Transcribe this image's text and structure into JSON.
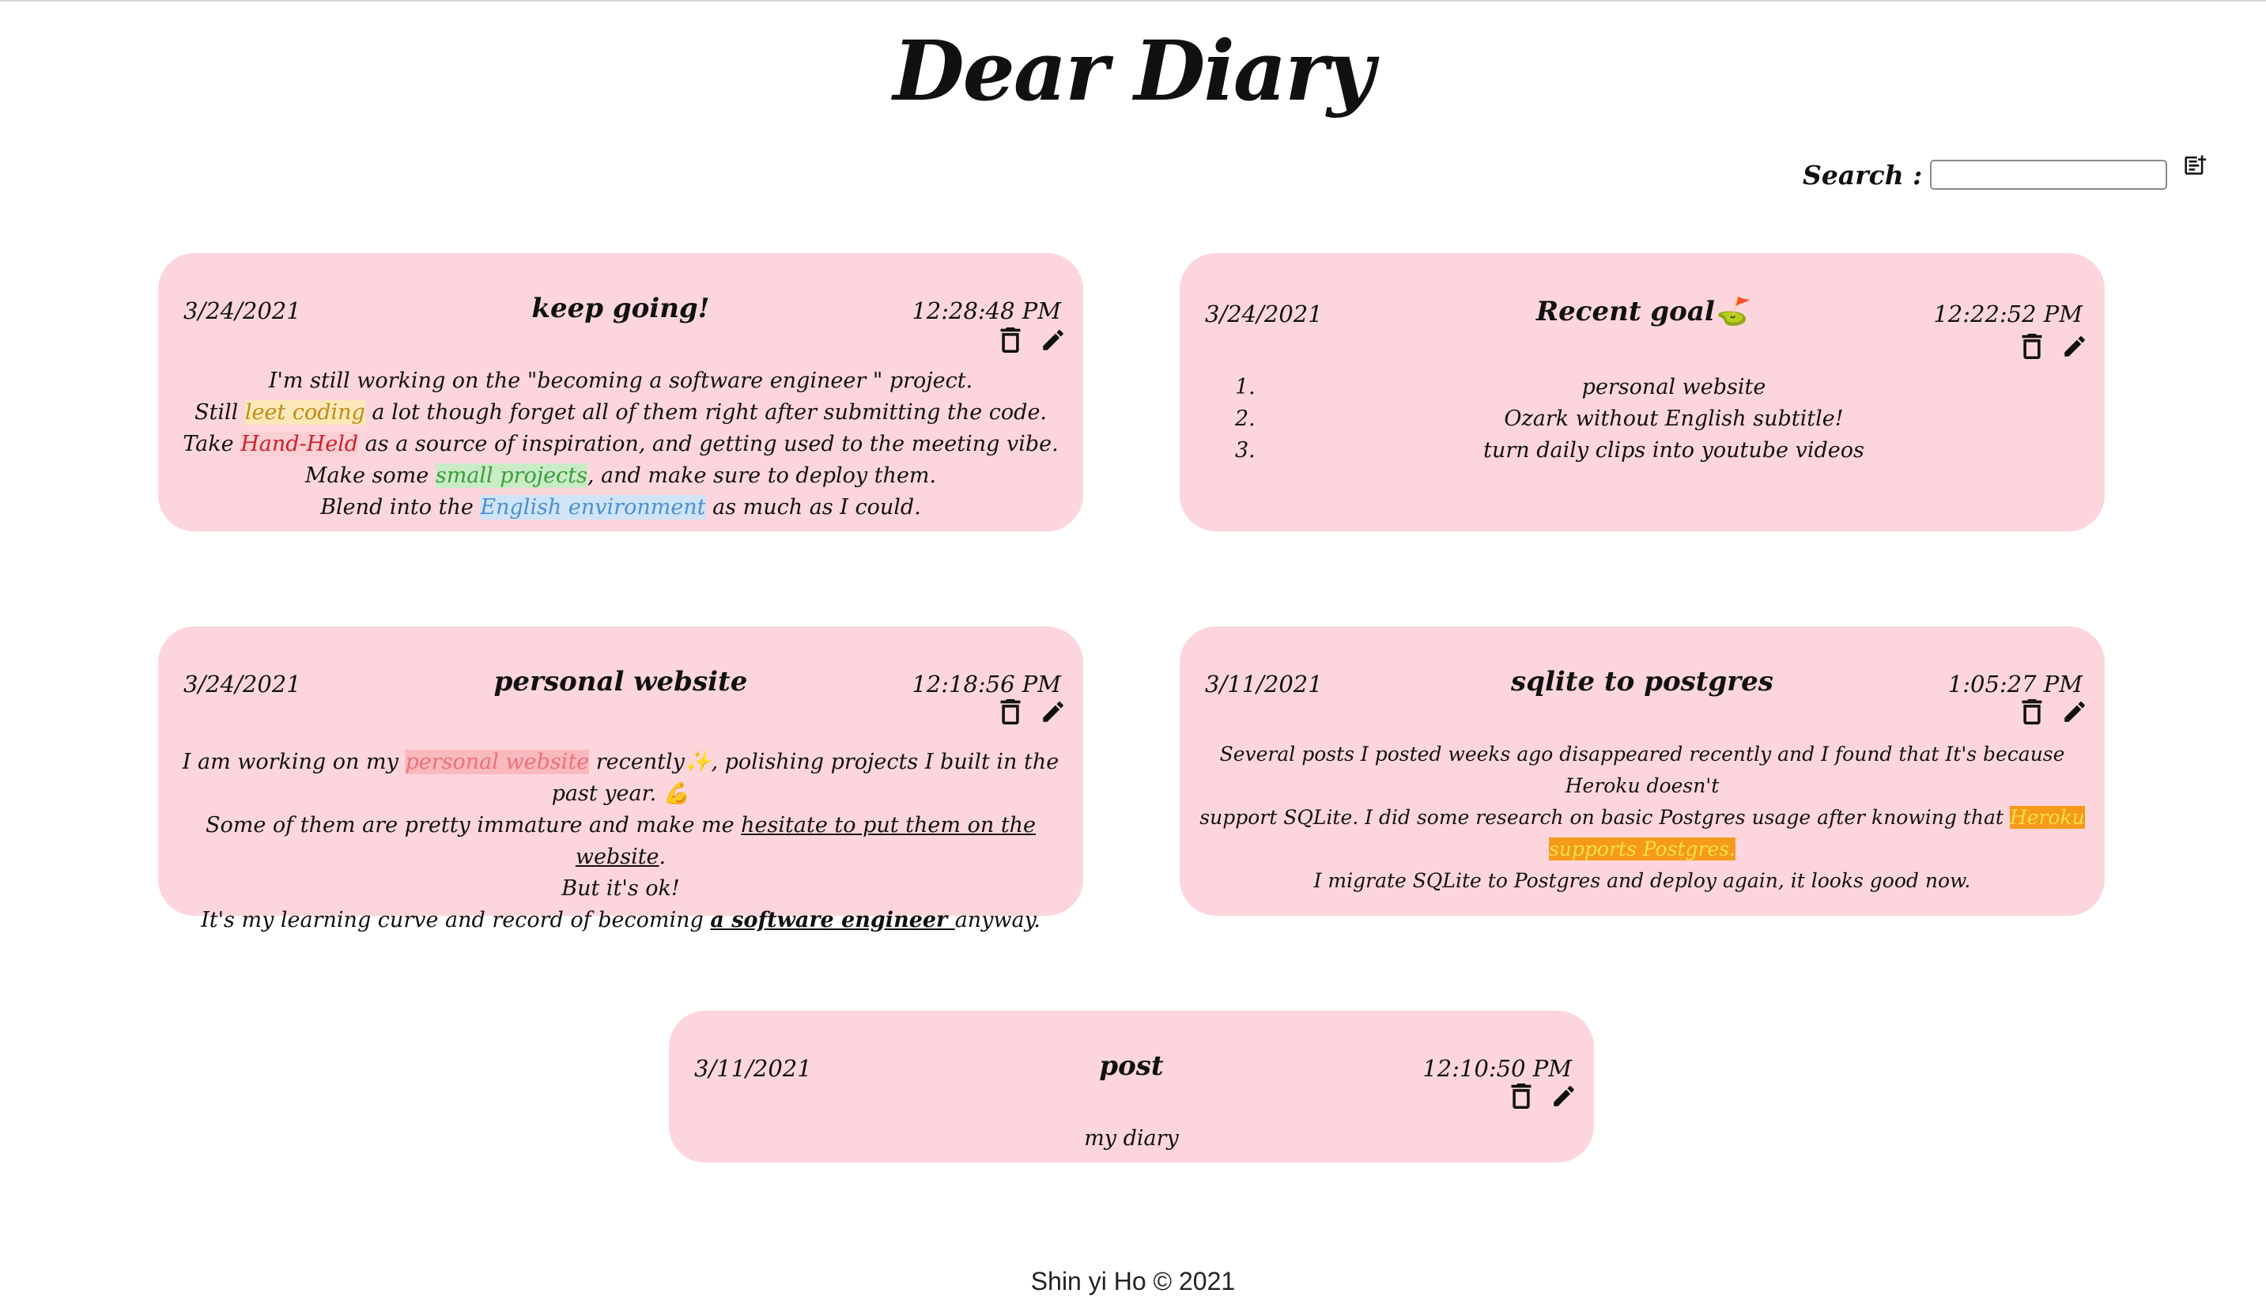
{
  "header": {
    "title": "Dear Diary"
  },
  "search": {
    "label": "Search :",
    "value": "",
    "placeholder": ""
  },
  "add_icon": "note-add-icon",
  "cards": {
    "c1": {
      "date": "3/24/2021",
      "title": "keep going!",
      "time": "12:28:48 PM",
      "lines": {
        "l1": "I'm still working on the \"becoming a software engineer \" project.",
        "l2_a": "Still ",
        "l2_hl": "leet coding",
        "l2_b": " a lot though forget all of them right after submitting the code.",
        "l3_a": "Take ",
        "l3_hl": "Hand-Held",
        "l3_b": " as a source of inspiration, and getting used to the meeting vibe.",
        "l4_a": "Make some ",
        "l4_hl": "small projects",
        "l4_b": ", and make sure to deploy them.",
        "l5_a": "Blend into the ",
        "l5_hl": "English environment",
        "l5_b": " as much as I could."
      }
    },
    "c2": {
      "date": "3/24/2021",
      "title": "Recent goal⛳",
      "time": "12:22:52 PM",
      "items": [
        {
          "num": "1.",
          "text": "personal website"
        },
        {
          "num": "2.",
          "text": "Ozark without English subtitle!"
        },
        {
          "num": "3.",
          "text": "turn daily clips into youtube videos"
        }
      ]
    },
    "c3": {
      "date": "3/24/2021",
      "title": "personal website",
      "time": "12:18:56 PM",
      "lines": {
        "l1_a": "I am working on my ",
        "l1_hl": "personal website",
        "l1_b": " recently✨, polishing projects I built in the past year. 💪",
        "l2_a": "Some of them are pretty immature and make me ",
        "l2_u": "hesitate to put them on the website",
        "l2_b": ".",
        "l3": "But it's ok!",
        "l4_a": "It's my learning curve and record of becoming ",
        "l4_bu": "a software engineer ",
        "l4_b": "anyway."
      }
    },
    "c4": {
      "date": "3/11/2021",
      "title": "sqlite to postgres",
      "time": "1:05:27 PM",
      "lines": {
        "l1": "Several posts I posted weeks ago disappeared recently and I found that It's because Heroku doesn't",
        "l2_a": "support SQLite. I did some research on basic Postgres usage after knowing that ",
        "l2_hl": "Heroku supports Postgres.",
        "l3": "I migrate SQLite to Postgres and deploy again, it looks good now."
      }
    },
    "c5": {
      "date": "3/11/2021",
      "title": "post",
      "time": "12:10:50 PM",
      "body": "my diary"
    }
  },
  "actions": {
    "delete_icon": "trash-icon",
    "edit_icon": "pencil-icon"
  },
  "footer": {
    "text": "Shin yi Ho © 2021"
  }
}
